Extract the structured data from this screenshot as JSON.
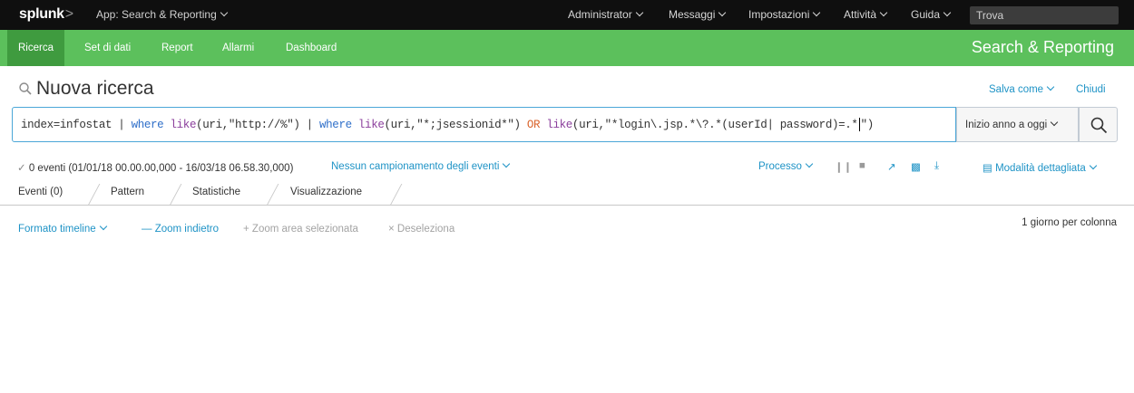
{
  "topbar": {
    "logo": "splunk",
    "logo_suffix": ">",
    "app_menu": "App: Search & Reporting",
    "nav": [
      "Administrator",
      "Messaggi",
      "Impostazioni",
      "Attività",
      "Guida"
    ],
    "find_placeholder": "Trova"
  },
  "appbar": {
    "tabs": [
      "Ricerca",
      "Set di dati",
      "Report",
      "Allarmi",
      "Dashboard"
    ],
    "app_title": "Search & Reporting",
    "color": "#5cc05c"
  },
  "header": {
    "title": "Nuova ricerca",
    "save_as": "Salva come",
    "close": "Chiudi"
  },
  "query": {
    "parts": [
      "index=infostat | ",
      "where",
      " ",
      "like",
      "(uri,\"http://%\") | ",
      "where",
      " ",
      "like",
      "(uri,\"*;jsessionid*\") ",
      "OR",
      " ",
      "like",
      "(uri,\"*login\\.jsp.*\\?.*(userId| password)=.*",
      "\")"
    ],
    "time_range": "Inizio anno a oggi"
  },
  "status": {
    "events": "0 eventi (01/01/18 00.00.00,000 - 16/03/18 06.58.30,000)",
    "sampling": "Nessun campionamento degli eventi",
    "job": "Processo",
    "mode": "Modalità dettagliata"
  },
  "tabs": [
    "Eventi (0)",
    "Pattern",
    "Statistiche",
    "Visualizzazione"
  ],
  "timeline": {
    "format": "Formato timeline",
    "zoom_out": "Zoom indietro",
    "zoom_selection": "Zoom area selezionata",
    "deselect": "Deseleziona",
    "per_column": "1 giorno per colonna"
  },
  "icons": [
    "search-icon",
    "chevron-down-icon",
    "checkmark-icon",
    "pause-icon",
    "stop-icon",
    "share-icon",
    "print-icon",
    "export-icon",
    "list-icon"
  ]
}
